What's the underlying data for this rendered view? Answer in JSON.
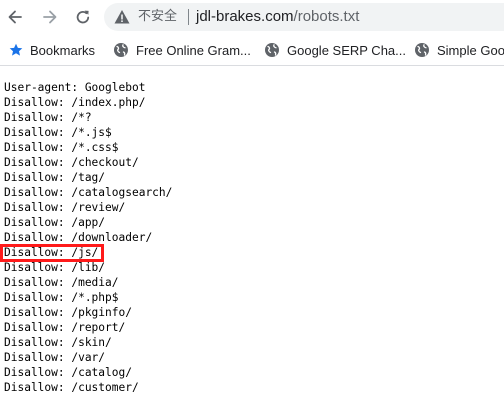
{
  "browser": {
    "security_label": "不安全",
    "url_host": "jdl-brakes.com",
    "url_path": "/robots.txt",
    "colors": {
      "toolbar_bg": "#ffffff",
      "omnibox_bg": "#f1f3f4",
      "highlight": "#ff1a1a",
      "bookmark_star": "#1a73e8"
    },
    "icons": {
      "back": "back-arrow-icon",
      "forward": "forward-arrow-icon",
      "reload": "reload-icon",
      "security": "warning-triangle-icon"
    }
  },
  "bookmarks": [
    {
      "label": "Bookmarks",
      "icon": "star-icon"
    },
    {
      "label": "Free Online Gram...",
      "icon": "globe-icon"
    },
    {
      "label": "Google SERP Cha...",
      "icon": "globe-icon"
    },
    {
      "label": "Simple Goo",
      "icon": "globe-icon"
    }
  ],
  "robots_lines": [
    "User-agent: Googlebot",
    "Disallow: /index.php/",
    "Disallow: /*?",
    "Disallow: /*.js$",
    "Disallow: /*.css$",
    "Disallow: /checkout/",
    "Disallow: /tag/",
    "Disallow: /catalogsearch/",
    "Disallow: /review/",
    "Disallow: /app/",
    "Disallow: /downloader/",
    "Disallow: /js/",
    "Disallow: /lib/",
    "Disallow: /media/",
    "Disallow: /*.php$",
    "Disallow: /pkginfo/",
    "Disallow: /report/",
    "Disallow: /skin/",
    "Disallow: /var/",
    "Disallow: /catalog/",
    "Disallow: /customer/"
  ],
  "highlighted_line": "Disallow: /js/"
}
